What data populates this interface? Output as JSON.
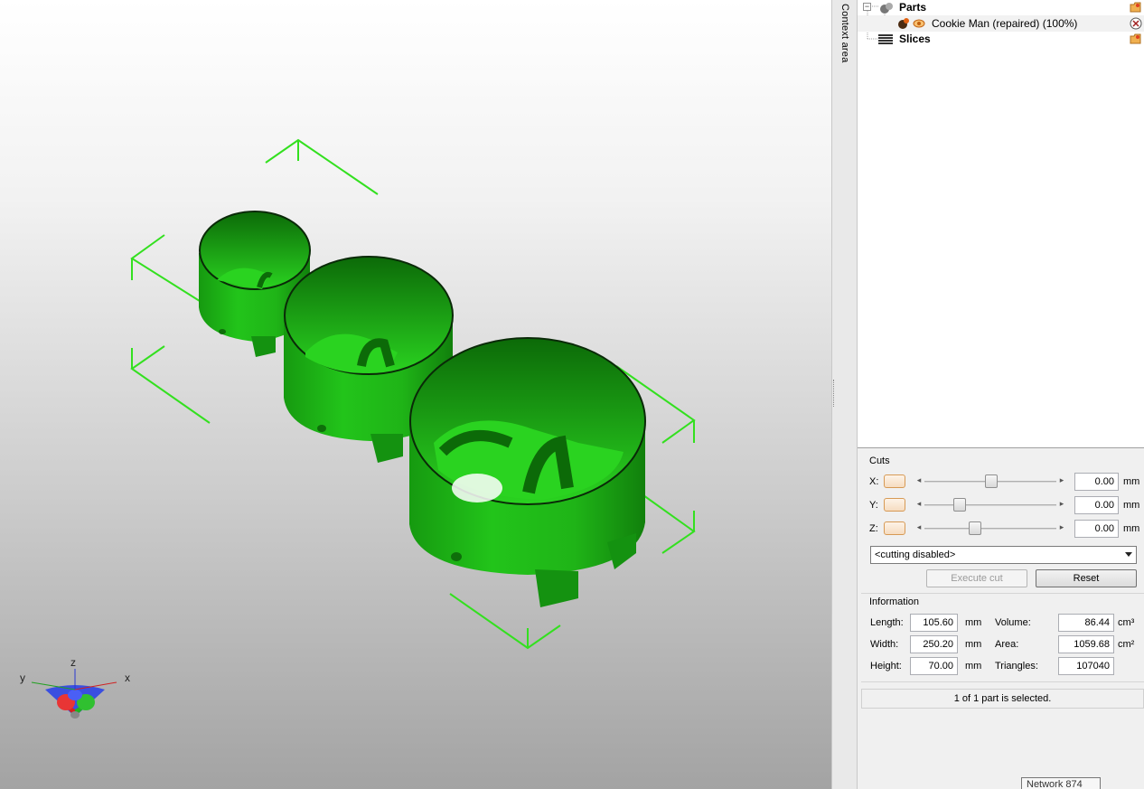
{
  "viewport": {
    "axes": {
      "x": "x",
      "y": "y",
      "z": "z"
    },
    "model_color": "#22c41a",
    "bounding_box_color": "#33e01f"
  },
  "context_strip": {
    "label": "Context area"
  },
  "tree": {
    "parts": {
      "label": "Parts"
    },
    "part_item": {
      "label": "Cookie Man (repaired) (100%)"
    },
    "slices": {
      "label": "Slices"
    }
  },
  "cuts": {
    "title": "Cuts",
    "rows": [
      {
        "axis": "X:",
        "value": "0.00",
        "unit": "mm",
        "slider_fraction": 0.55
      },
      {
        "axis": "Y:",
        "value": "0.00",
        "unit": "mm",
        "slider_fraction": 0.3
      },
      {
        "axis": "Z:",
        "value": "0.00",
        "unit": "mm",
        "slider_fraction": 0.4
      }
    ],
    "mode": "<cutting disabled>",
    "execute_label": "Execute cut",
    "reset_label": "Reset"
  },
  "information": {
    "title": "Information",
    "length_label": "Length:",
    "length_value": "105.60",
    "length_unit": "mm",
    "width_label": "Width:",
    "width_value": "250.20",
    "width_unit": "mm",
    "height_label": "Height:",
    "height_value": "70.00",
    "height_unit": "mm",
    "volume_label": "Volume:",
    "volume_value": "86.44",
    "volume_unit": "cm³",
    "area_label": "Area:",
    "area_value": "1059.68",
    "area_unit": "cm²",
    "triangles_label": "Triangles:",
    "triangles_value": "107040"
  },
  "status": {
    "text": "1 of 1 part is selected."
  },
  "network": {
    "text": "Network  874"
  }
}
